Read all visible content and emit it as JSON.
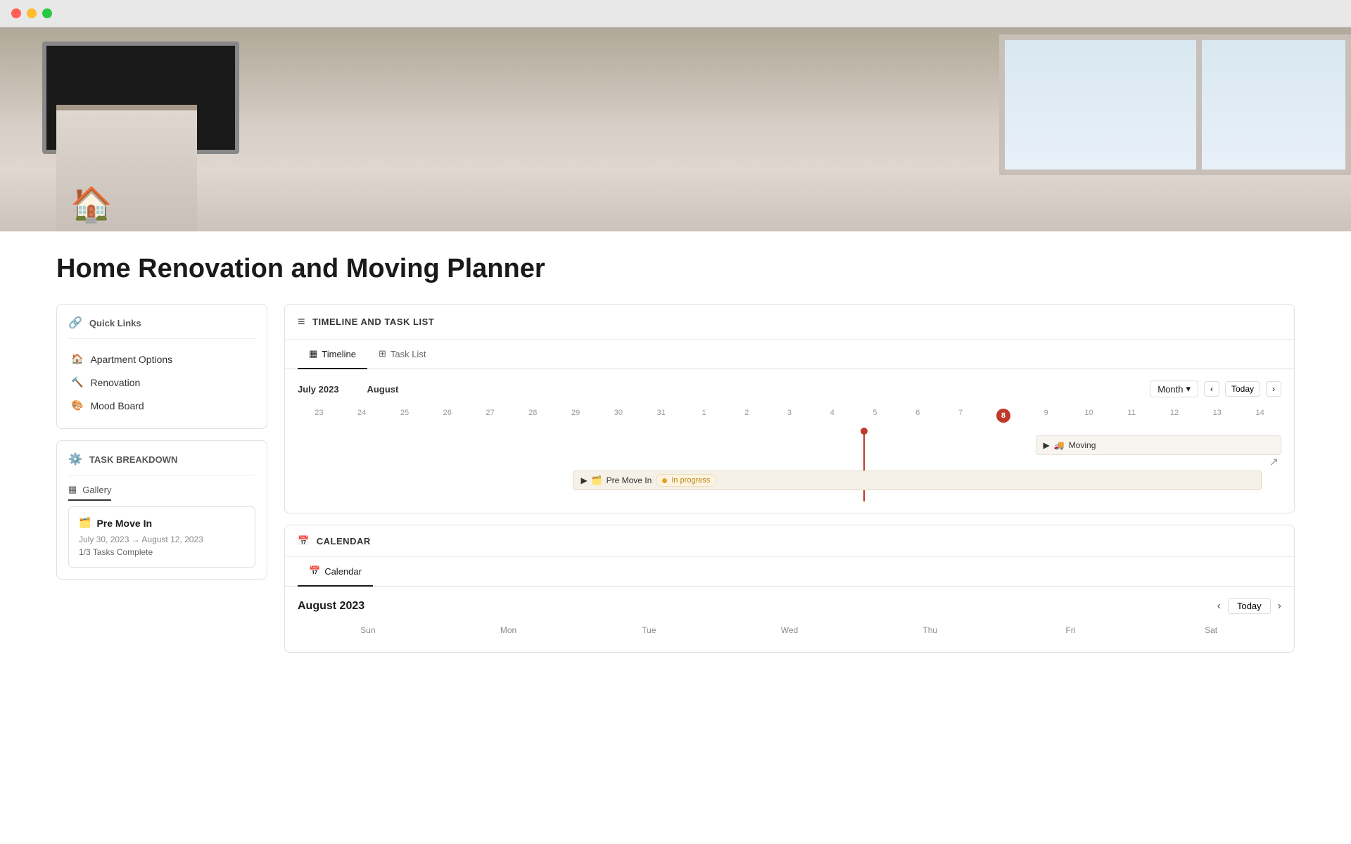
{
  "browser": {
    "traffic_lights": [
      "red",
      "yellow",
      "green"
    ]
  },
  "page": {
    "title": "Home Renovation and Moving Planner",
    "hero_icon": "🏠"
  },
  "sidebar": {
    "quick_links": {
      "header": "Quick Links",
      "header_icon": "🔗",
      "items": [
        {
          "label": "Apartment Options",
          "icon": "🏠"
        },
        {
          "label": "Renovation",
          "icon": "🔨"
        },
        {
          "label": "Mood Board",
          "icon": "🎨"
        }
      ]
    },
    "task_breakdown": {
      "header": "TASK BREAKDOWN",
      "header_icon": "⚙️",
      "gallery_label": "Gallery",
      "gallery_icon": "▦",
      "task_card": {
        "title": "Pre Move In",
        "title_icon": "🗂️",
        "date_range": "July 30, 2023 → August 12, 2023",
        "progress": "1/3 Tasks Complete"
      }
    }
  },
  "timeline_panel": {
    "header": "TIMELINE AND TASK LIST",
    "header_icon": "≡",
    "tabs": [
      {
        "label": "Timeline",
        "icon": "▦",
        "active": true
      },
      {
        "label": "Task List",
        "icon": "⊞",
        "active": false
      }
    ],
    "month_selector": "Month",
    "today_btn": "Today",
    "prev_btn": "‹",
    "next_btn": "›",
    "months": [
      {
        "label": "July 2023"
      },
      {
        "label": "August"
      }
    ],
    "dates": [
      23,
      24,
      25,
      26,
      27,
      28,
      29,
      30,
      31,
      1,
      2,
      3,
      4,
      5,
      6,
      7,
      8,
      9,
      10,
      11,
      12,
      13,
      14
    ],
    "today_date": 8,
    "tasks": [
      {
        "label": "Pre Move In",
        "status": "In progress",
        "icon": "🗂️"
      },
      {
        "label": "Moving",
        "icon": "🚚"
      }
    ]
  },
  "calendar_panel": {
    "header": "CALENDAR",
    "header_icon": "📅",
    "tab_label": "Calendar",
    "tab_icon": "📅",
    "month_title": "August 2023",
    "today_btn": "Today",
    "prev_btn": "‹",
    "next_btn": "›",
    "day_labels": [
      "Sun",
      "Mon",
      "Tue",
      "Wed",
      "Thu",
      "Fri",
      "Sat"
    ]
  }
}
